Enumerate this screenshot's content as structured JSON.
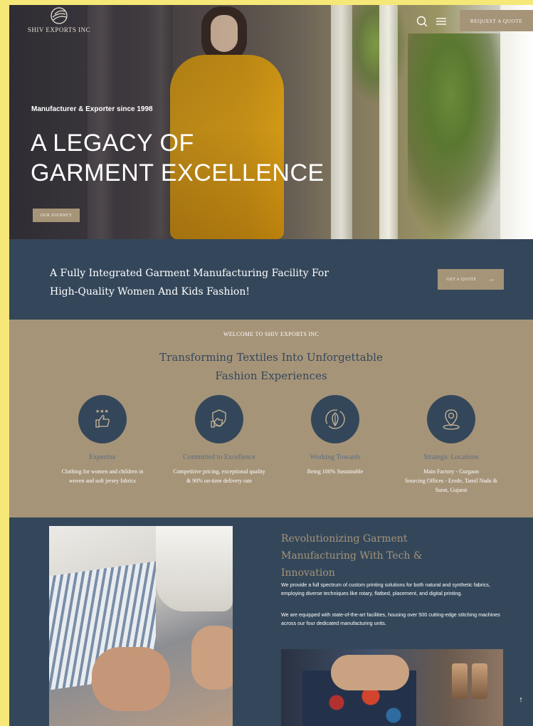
{
  "header": {
    "logo_text": "SHIV EXPORTS INC",
    "cta_label": "REQUEST A QUOTE",
    "search_icon": "search-icon",
    "menu_icon": "menu-icon"
  },
  "hero": {
    "tagline": "Manufacturer & Exporter since 1998",
    "title_line1": "A LEGACY OF",
    "title_line2": "GARMENT EXCELLENCE",
    "button_label": "OUR JOURNEY"
  },
  "band": {
    "text_line1": "A Fully Integrated Garment Manufacturing Facility For",
    "text_line2": "High-Quality Women And Kids Fashion!",
    "button_label": "GET A QUOTE",
    "button_icon": "arrow-right-icon"
  },
  "welcome": {
    "eyebrow": "WELCOME TO SHIV EXPORTS INC",
    "title_line1": "Transforming Textiles Into Unforgettable",
    "title_line2": "Fashion Experiences",
    "features": [
      {
        "icon": "expertise-icon",
        "title": "Expertise",
        "desc": "Clothing for women and children in\nwoven and soft jersey fabrics"
      },
      {
        "icon": "excellence-icon",
        "title": "Committed to Excellence",
        "desc": "Competitive pricing, exceptional quality\n& 90% on-time delivery rate"
      },
      {
        "icon": "leaf-icon",
        "title": "Working Towards",
        "desc": "Being 100% Sustainable"
      },
      {
        "icon": "location-pin-icon",
        "title": "Strategic Locations",
        "desc": "Main Factory - Gurgaon\nSourcing Offices - Erode, Tamil Nadu &\nSurat, Gujarat"
      }
    ]
  },
  "innovation": {
    "title": "Revolutionizing Garment Manufacturing With Tech & Innovation",
    "para1": "We provide a full spectrum of custom printing solutions for both natural and synthetic fabrics, employing diverse techniques like rotary, flatbed, placement, and digital printing.",
    "para2": "We are equipped with state-of-the-art facilities, housing over 500 cutting-edge stitching machines across our four dedicated manufacturing units.",
    "scroll_top_icon": "arrow-up-icon"
  },
  "colors": {
    "navy": "#34475a",
    "tan": "#a69479",
    "frame": "#f5e878"
  }
}
